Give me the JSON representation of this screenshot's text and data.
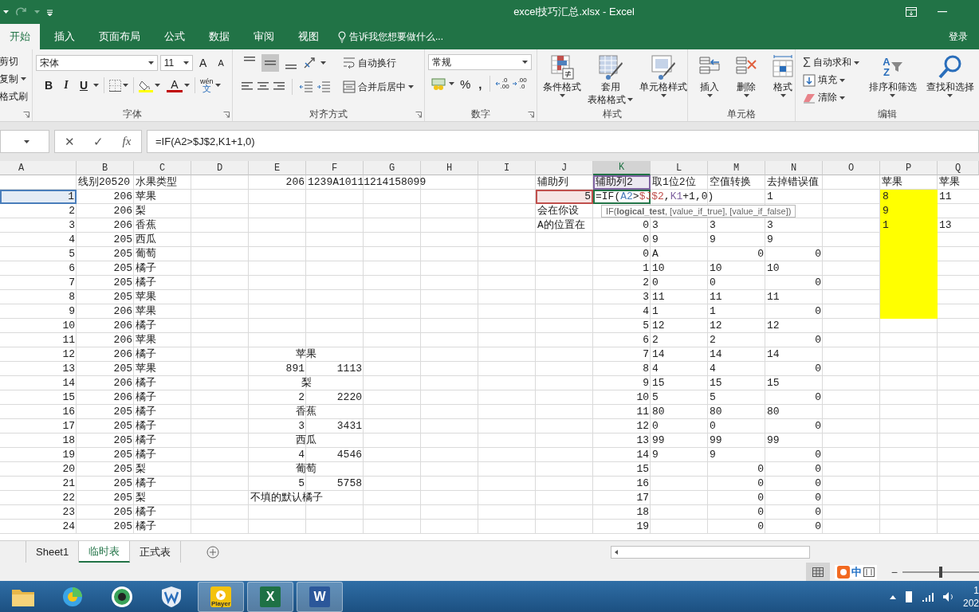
{
  "window": {
    "title": "excel技巧汇总.xlsx - Excel"
  },
  "tabs": [
    {
      "label": "开始",
      "selected": true
    },
    {
      "label": "插入",
      "selected": false
    },
    {
      "label": "页面布局",
      "selected": false
    },
    {
      "label": "公式",
      "selected": false
    },
    {
      "label": "数据",
      "selected": false
    },
    {
      "label": "审阅",
      "selected": false
    },
    {
      "label": "视图",
      "selected": false
    }
  ],
  "tell_me": "告诉我您想要做什么...",
  "sign_in": "登录",
  "ribbon": {
    "clipboard": {
      "cut": "剪切",
      "copy": "复制",
      "format_painter": "格式刷"
    },
    "font": {
      "label": "字体",
      "font_name": "宋体",
      "font_size": "11",
      "grow": "A",
      "shrink": "A",
      "bold": "B",
      "italic": "I",
      "underline": "U",
      "font_color": "A",
      "phonetic_top": "wén",
      "phonetic_bottom": "文"
    },
    "alignment": {
      "label": "对齐方式",
      "vertical": [
        {
          "selected": false
        },
        {
          "selected": true
        },
        {
          "selected": false
        }
      ],
      "wrap_text": "自动换行",
      "merge_center": "合并后居中"
    },
    "number": {
      "label": "数字",
      "format": "常规",
      "percent": "%",
      "comma": ",",
      "decimals": [
        {
          "top": ".0",
          "bottom": ".00"
        },
        {
          "top": ".00",
          "bottom": ".0"
        }
      ]
    },
    "styles": {
      "label": "样式",
      "conditional": "条件格式",
      "table_top": "套用",
      "table_bottom": "表格格式",
      "cell_styles": "单元格样式"
    },
    "cells": {
      "label": "单元格",
      "insert": "插入",
      "delete": "删除",
      "format": "格式"
    },
    "editing": {
      "label": "编辑",
      "sigma": "Σ",
      "autosum": "自动求和",
      "fill": "填充",
      "clear": "清除",
      "sort_letters": [
        "A",
        "Z"
      ],
      "sort": "排序和筛选",
      "find": "查找和选择"
    }
  },
  "formula_bar": {
    "cancel": "✕",
    "enter": "✓",
    "function": "fx",
    "formula": "=IF(A2>$J$2,K1+1,0)"
  },
  "sheet": {
    "columns": [
      {
        "label": "A",
        "selected": false
      },
      {
        "label": "B",
        "selected": false
      },
      {
        "label": "C",
        "selected": false
      },
      {
        "label": "D",
        "selected": false
      },
      {
        "label": "E",
        "selected": false
      },
      {
        "label": "F",
        "selected": false
      },
      {
        "label": "G",
        "selected": false
      },
      {
        "label": "H",
        "selected": false
      },
      {
        "label": "I",
        "selected": false
      },
      {
        "label": "J",
        "selected": false
      },
      {
        "label": "K",
        "selected": true
      },
      {
        "label": "L",
        "selected": false
      },
      {
        "label": "M",
        "selected": false
      },
      {
        "label": "N",
        "selected": false
      },
      {
        "label": "O",
        "selected": false
      },
      {
        "label": "P",
        "selected": false
      },
      {
        "label": "Q",
        "selected": false
      }
    ],
    "rows": [
      {
        "b": {
          "kind": "text",
          "text": "线别20520"
        },
        "c": {
          "kind": "text",
          "text": "水果类型"
        },
        "e": {
          "kind": "number",
          "text": "206"
        },
        "f": {
          "kind": "text",
          "text": "1239A10111214158099"
        },
        "j": {
          "kind": "text",
          "text": "辅助列"
        },
        "k": {
          "kind": "text",
          "text": "辅助列2",
          "ref": {
            "color": "#8064a2"
          }
        },
        "l": {
          "kind": "text",
          "text": "取1位2位"
        },
        "m": {
          "kind": "text",
          "text": "空值转换"
        },
        "n": {
          "kind": "text",
          "text": "去掉错误值"
        },
        "p": {
          "kind": "text",
          "text": "苹果"
        },
        "q": {
          "kind": "text",
          "text": "苹果"
        }
      },
      {
        "a": {
          "kind": "number",
          "text": "1",
          "ref": {
            "color": "#4a7ebb"
          }
        },
        "b": {
          "kind": "number",
          "text": "206"
        },
        "c": {
          "kind": "text",
          "text": "苹果"
        },
        "j": {
          "kind": "number",
          "text": "5",
          "ref": {
            "color": "#c0504d"
          }
        },
        "k": {
          "kind": "formula",
          "segments": [
            {
              "text": "=IF("
            },
            {
              "text": "A2",
              "color": "#4a7ebb"
            },
            {
              "text": ">"
            },
            {
              "text": "$J$2",
              "color": "#c0504d"
            },
            {
              "text": ","
            },
            {
              "text": "K1",
              "color": "#8064a2"
            },
            {
              "text": "+1,0)"
            }
          ]
        },
        "n": {
          "kind": "text",
          "text": "1"
        },
        "p": {
          "kind": "text",
          "text": "8",
          "fill": {
            "color": "#ffff00"
          }
        },
        "q": {
          "kind": "text",
          "text": "11"
        }
      },
      {
        "a": {
          "kind": "number",
          "text": "2"
        },
        "b": {
          "kind": "number",
          "text": "206"
        },
        "c": {
          "kind": "text",
          "text": "梨"
        },
        "j": {
          "kind": "text",
          "text": "会在你设"
        },
        "p": {
          "kind": "text",
          "text": "9",
          "fill": {
            "color": "#ffff00"
          }
        }
      },
      {
        "a": {
          "kind": "number",
          "text": "3"
        },
        "b": {
          "kind": "number",
          "text": "206"
        },
        "c": {
          "kind": "text",
          "text": "香蕉"
        },
        "j": {
          "kind": "text",
          "text": "A的位置在"
        },
        "k": {
          "kind": "number",
          "text": "0"
        },
        "l": {
          "kind": "text",
          "text": "3"
        },
        "m": {
          "kind": "text",
          "text": "3"
        },
        "n": {
          "kind": "text",
          "text": "3"
        },
        "p": {
          "kind": "text",
          "text": "1",
          "fill": {
            "color": "#ffff00"
          }
        },
        "q": {
          "kind": "text",
          "text": "13"
        }
      },
      {
        "a": {
          "kind": "number",
          "text": "4"
        },
        "b": {
          "kind": "number",
          "text": "205"
        },
        "c": {
          "kind": "text",
          "text": "西瓜"
        },
        "k": {
          "kind": "number",
          "text": "0"
        },
        "l": {
          "kind": "text",
          "text": "9"
        },
        "m": {
          "kind": "text",
          "text": "9"
        },
        "n": {
          "kind": "text",
          "text": "9"
        },
        "p": {
          "kind": "text",
          "fill": {
            "color": "#ffff00"
          }
        }
      },
      {
        "a": {
          "kind": "number",
          "text": "5"
        },
        "b": {
          "kind": "number",
          "text": "205"
        },
        "c": {
          "kind": "text",
          "text": "葡萄"
        },
        "k": {
          "kind": "number",
          "text": "0"
        },
        "l": {
          "kind": "text",
          "text": "A"
        },
        "m": {
          "kind": "number",
          "text": "0"
        },
        "n": {
          "kind": "number",
          "text": "0"
        },
        "p": {
          "kind": "text",
          "fill": {
            "color": "#ffff00"
          }
        }
      },
      {
        "a": {
          "kind": "number",
          "text": "6"
        },
        "b": {
          "kind": "number",
          "text": "205"
        },
        "c": {
          "kind": "text",
          "text": "橘子"
        },
        "k": {
          "kind": "number",
          "text": "1"
        },
        "l": {
          "kind": "text",
          "text": "10"
        },
        "m": {
          "kind": "text",
          "text": "10"
        },
        "n": {
          "kind": "text",
          "text": "10"
        },
        "p": {
          "kind": "text",
          "fill": {
            "color": "#ffff00"
          }
        }
      },
      {
        "a": {
          "kind": "number",
          "text": "7"
        },
        "b": {
          "kind": "number",
          "text": "205"
        },
        "c": {
          "kind": "text",
          "text": "橘子"
        },
        "k": {
          "kind": "number",
          "text": "2"
        },
        "l": {
          "kind": "text",
          "text": "0"
        },
        "m": {
          "kind": "text",
          "text": "0"
        },
        "n": {
          "kind": "number",
          "text": "0"
        },
        "p": {
          "kind": "text",
          "fill": {
            "color": "#ffff00"
          }
        }
      },
      {
        "a": {
          "kind": "number",
          "text": "8"
        },
        "b": {
          "kind": "number",
          "text": "205"
        },
        "c": {
          "kind": "text",
          "text": "苹果"
        },
        "k": {
          "kind": "number",
          "text": "3"
        },
        "l": {
          "kind": "text",
          "text": "11"
        },
        "m": {
          "kind": "text",
          "text": "11"
        },
        "n": {
          "kind": "text",
          "text": "11"
        },
        "p": {
          "kind": "text",
          "fill": {
            "color": "#ffff00"
          }
        }
      },
      {
        "a": {
          "kind": "number",
          "text": "9"
        },
        "b": {
          "kind": "number",
          "text": "206"
        },
        "c": {
          "kind": "text",
          "text": "苹果"
        },
        "k": {
          "kind": "number",
          "text": "4"
        },
        "l": {
          "kind": "text",
          "text": "1"
        },
        "m": {
          "kind": "text",
          "text": "1"
        },
        "n": {
          "kind": "number",
          "text": "0"
        },
        "p": {
          "kind": "text",
          "fill": {
            "color": "#ffff00"
          }
        }
      },
      {
        "a": {
          "kind": "number",
          "text": "10"
        },
        "b": {
          "kind": "number",
          "text": "206"
        },
        "c": {
          "kind": "text",
          "text": "橘子"
        },
        "k": {
          "kind": "number",
          "text": "5"
        },
        "l": {
          "kind": "text",
          "text": "12"
        },
        "m": {
          "kind": "text",
          "text": "12"
        },
        "n": {
          "kind": "text",
          "text": "12"
        }
      },
      {
        "a": {
          "kind": "number",
          "text": "11"
        },
        "b": {
          "kind": "number",
          "text": "206"
        },
        "c": {
          "kind": "text",
          "text": "苹果"
        },
        "k": {
          "kind": "number",
          "text": "6"
        },
        "l": {
          "kind": "text",
          "text": "2"
        },
        "m": {
          "kind": "text",
          "text": "2"
        },
        "n": {
          "kind": "number",
          "text": "0"
        }
      },
      {
        "a": {
          "kind": "number",
          "text": "12"
        },
        "b": {
          "kind": "number",
          "text": "206"
        },
        "c": {
          "kind": "text",
          "text": "橘子"
        },
        "e": {
          "kind": "title",
          "text": "苹果"
        },
        "k": {
          "kind": "number",
          "text": "7"
        },
        "l": {
          "kind": "text",
          "text": "14"
        },
        "m": {
          "kind": "text",
          "text": "14"
        },
        "n": {
          "kind": "text",
          "text": "14"
        }
      },
      {
        "a": {
          "kind": "number",
          "text": "13"
        },
        "b": {
          "kind": "number",
          "text": "205"
        },
        "c": {
          "kind": "text",
          "text": "苹果"
        },
        "e": {
          "kind": "number",
          "text": "891"
        },
        "f": {
          "kind": "number",
          "text": "1113"
        },
        "k": {
          "kind": "number",
          "text": "8"
        },
        "l": {
          "kind": "text",
          "text": "4"
        },
        "m": {
          "kind": "text",
          "text": "4"
        },
        "n": {
          "kind": "number",
          "text": "0"
        }
      },
      {
        "a": {
          "kind": "number",
          "text": "14"
        },
        "b": {
          "kind": "number",
          "text": "206"
        },
        "c": {
          "kind": "text",
          "text": "橘子"
        },
        "e": {
          "kind": "title",
          "text": "梨"
        },
        "k": {
          "kind": "number",
          "text": "9"
        },
        "l": {
          "kind": "text",
          "text": "15"
        },
        "m": {
          "kind": "text",
          "text": "15"
        },
        "n": {
          "kind": "text",
          "text": "15"
        }
      },
      {
        "a": {
          "kind": "number",
          "text": "15"
        },
        "b": {
          "kind": "number",
          "text": "206"
        },
        "c": {
          "kind": "text",
          "text": "橘子"
        },
        "e": {
          "kind": "number",
          "text": "2"
        },
        "f": {
          "kind": "number",
          "text": "2220"
        },
        "k": {
          "kind": "number",
          "text": "10"
        },
        "l": {
          "kind": "text",
          "text": "5"
        },
        "m": {
          "kind": "text",
          "text": "5"
        },
        "n": {
          "kind": "number",
          "text": "0"
        }
      },
      {
        "a": {
          "kind": "number",
          "text": "16"
        },
        "b": {
          "kind": "number",
          "text": "205"
        },
        "c": {
          "kind": "text",
          "text": "橘子"
        },
        "e": {
          "kind": "title",
          "text": "香蕉"
        },
        "k": {
          "kind": "number",
          "text": "11"
        },
        "l": {
          "kind": "text",
          "text": "80"
        },
        "m": {
          "kind": "text",
          "text": "80"
        },
        "n": {
          "kind": "text",
          "text": "80"
        }
      },
      {
        "a": {
          "kind": "number",
          "text": "17"
        },
        "b": {
          "kind": "number",
          "text": "205"
        },
        "c": {
          "kind": "text",
          "text": "橘子"
        },
        "e": {
          "kind": "number",
          "text": "3"
        },
        "f": {
          "kind": "number",
          "text": "3431"
        },
        "k": {
          "kind": "number",
          "text": "12"
        },
        "l": {
          "kind": "text",
          "text": "0"
        },
        "m": {
          "kind": "text",
          "text": "0"
        },
        "n": {
          "kind": "number",
          "text": "0"
        }
      },
      {
        "a": {
          "kind": "number",
          "text": "18"
        },
        "b": {
          "kind": "number",
          "text": "205"
        },
        "c": {
          "kind": "text",
          "text": "橘子"
        },
        "e": {
          "kind": "title",
          "text": "西瓜"
        },
        "k": {
          "kind": "number",
          "text": "13"
        },
        "l": {
          "kind": "text",
          "text": "99"
        },
        "m": {
          "kind": "text",
          "text": "99"
        },
        "n": {
          "kind": "text",
          "text": "99"
        }
      },
      {
        "a": {
          "kind": "number",
          "text": "19"
        },
        "b": {
          "kind": "number",
          "text": "205"
        },
        "c": {
          "kind": "text",
          "text": "橘子"
        },
        "e": {
          "kind": "number",
          "text": "4"
        },
        "f": {
          "kind": "number",
          "text": "4546"
        },
        "k": {
          "kind": "number",
          "text": "14"
        },
        "l": {
          "kind": "text",
          "text": "9"
        },
        "m": {
          "kind": "text",
          "text": "9"
        },
        "n": {
          "kind": "number",
          "text": "0"
        }
      },
      {
        "a": {
          "kind": "number",
          "text": "20"
        },
        "b": {
          "kind": "number",
          "text": "205"
        },
        "c": {
          "kind": "text",
          "text": "梨"
        },
        "e": {
          "kind": "title",
          "text": "葡萄"
        },
        "k": {
          "kind": "number",
          "text": "15"
        },
        "m": {
          "kind": "number",
          "text": "0"
        },
        "n": {
          "kind": "number",
          "text": "0"
        }
      },
      {
        "a": {
          "kind": "number",
          "text": "21"
        },
        "b": {
          "kind": "number",
          "text": "205"
        },
        "c": {
          "kind": "text",
          "text": "橘子"
        },
        "e": {
          "kind": "number",
          "text": "5"
        },
        "f": {
          "kind": "number",
          "text": "5758"
        },
        "k": {
          "kind": "number",
          "text": "16"
        },
        "m": {
          "kind": "number",
          "text": "0"
        },
        "n": {
          "kind": "number",
          "text": "0"
        }
      },
      {
        "a": {
          "kind": "number",
          "text": "22"
        },
        "b": {
          "kind": "number",
          "text": "205"
        },
        "c": {
          "kind": "text",
          "text": "梨"
        },
        "e": {
          "kind": "text",
          "text": "不填的默认橘子"
        },
        "k": {
          "kind": "number",
          "text": "17"
        },
        "m": {
          "kind": "number",
          "text": "0"
        },
        "n": {
          "kind": "number",
          "text": "0"
        }
      },
      {
        "a": {
          "kind": "number",
          "text": "23"
        },
        "b": {
          "kind": "number",
          "text": "205"
        },
        "c": {
          "kind": "text",
          "text": "橘子"
        },
        "k": {
          "kind": "number",
          "text": "18"
        },
        "m": {
          "kind": "number",
          "text": "0"
        },
        "n": {
          "kind": "number",
          "text": "0"
        }
      },
      {
        "a": {
          "kind": "number",
          "text": "24"
        },
        "b": {
          "kind": "number",
          "text": "205"
        },
        "c": {
          "kind": "text",
          "text": "橘子"
        },
        "k": {
          "kind": "number",
          "text": "19"
        },
        "m": {
          "kind": "number",
          "text": "0"
        },
        "n": {
          "kind": "number",
          "text": "0"
        }
      }
    ],
    "tooltip": "IF(**logical_test**, [value_if_true], [value_if_false])"
  },
  "sheet_tabs": [
    {
      "label": "Sheet1",
      "selected": false
    },
    {
      "label": "临时表",
      "selected": true
    },
    {
      "label": "正式表",
      "selected": false
    }
  ],
  "status_bar": {
    "ime": "中",
    "zoom_out": "−",
    "zoom": {
      "level": 0.5
    }
  },
  "taskbar": {
    "apps": [
      {
        "kind": "folder",
        "running": false
      },
      {
        "kind": "browser",
        "running": false
      },
      {
        "kind": "camera",
        "running": false
      },
      {
        "kind": "shield",
        "running": false
      },
      {
        "kind": "player",
        "label": "Player",
        "running": true
      },
      {
        "kind": "excel",
        "label": "X",
        "running": true
      },
      {
        "kind": "word",
        "label": "W",
        "running": true
      }
    ],
    "clock_time": "1",
    "clock_date": "202"
  }
}
